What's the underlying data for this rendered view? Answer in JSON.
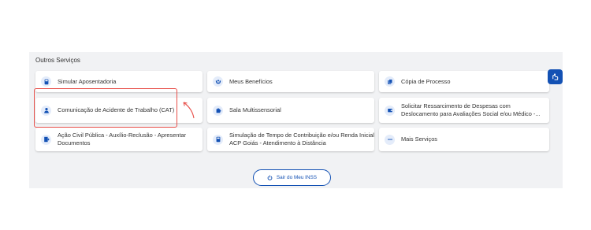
{
  "section": {
    "title": "Outros Serviços"
  },
  "cards": [
    {
      "label": "Simular Aposentadoria",
      "icon": "calculator-icon"
    },
    {
      "label": "Meus Benefícios",
      "icon": "hands-icon"
    },
    {
      "label": "Cópia de Processo",
      "icon": "copy-document-icon"
    },
    {
      "label": "Comunicação de Acidente de Trabalho (CAT)",
      "icon": "worker-icon"
    },
    {
      "label": "Sala Multissensorial",
      "icon": "puzzle-icon"
    },
    {
      "label": "Solicitar Ressarcimento de Despesas com Deslocamento para Avaliações Social e/ou Médico -...",
      "icon": "wallet-icon"
    },
    {
      "label": "Ação Civil Pública - Auxílio-Reclusão - Apresentar Documentos",
      "icon": "document-arrow-icon"
    },
    {
      "label": "Simulação de Tempo de Contribuição e/ou Renda Inicial ACP Goiás - Atendimento à Distância",
      "icon": "calculator-icon"
    },
    {
      "label": "Mais Serviços",
      "icon": "more-dots-icon"
    }
  ],
  "logout": {
    "label": "Sair do Meu INSS",
    "icon": "power-icon"
  },
  "accessibility": {
    "icon": "sign-language-icon"
  },
  "colors": {
    "primary": "#1351b4",
    "icon_bg": "#e4ecfa",
    "panel_bg": "#f1f2f4",
    "highlight": "#e8504a"
  }
}
